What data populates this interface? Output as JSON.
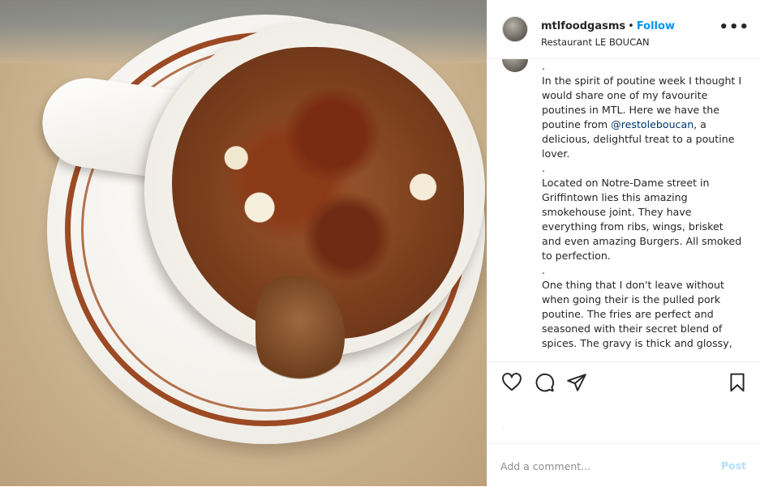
{
  "post": {
    "username": "mtlfoodgasms",
    "separator": "•",
    "follow_label": "Follow",
    "location": "Restaurant LE BOUCAN",
    "more_icon": "more-options-icon"
  },
  "caption": {
    "lines": [
      ".",
      "In the spirit of poutine week I thought I would share one of my favourite poutines in MTL. Here we have the poutine from ",
      "@restoleboucan",
      ", a delicious, delightful treat to a poutine lover.",
      ".",
      "Located on Notre-Dame street in Griffintown lies this amazing smokehouse joint. They have everything from ribs, wings, brisket and even amazing Burgers. All smoked to perfection.",
      ".",
      "One thing that I don't leave without when going their is the pulled pork poutine. The fries are perfect and seasoned with their secret blend of spices. The gravy is thick and glossy,"
    ]
  },
  "actions": {
    "like_icon": "heart-icon",
    "comment_icon": "comment-icon",
    "share_icon": "send-icon",
    "save_icon": "bookmark-icon"
  },
  "comment": {
    "placeholder": "Add a comment...",
    "post_label": "Post"
  },
  "colors": {
    "follow_blue": "#0095f6",
    "post_disabled": "#b2dffc",
    "text": "#262626",
    "border": "#efefef"
  }
}
